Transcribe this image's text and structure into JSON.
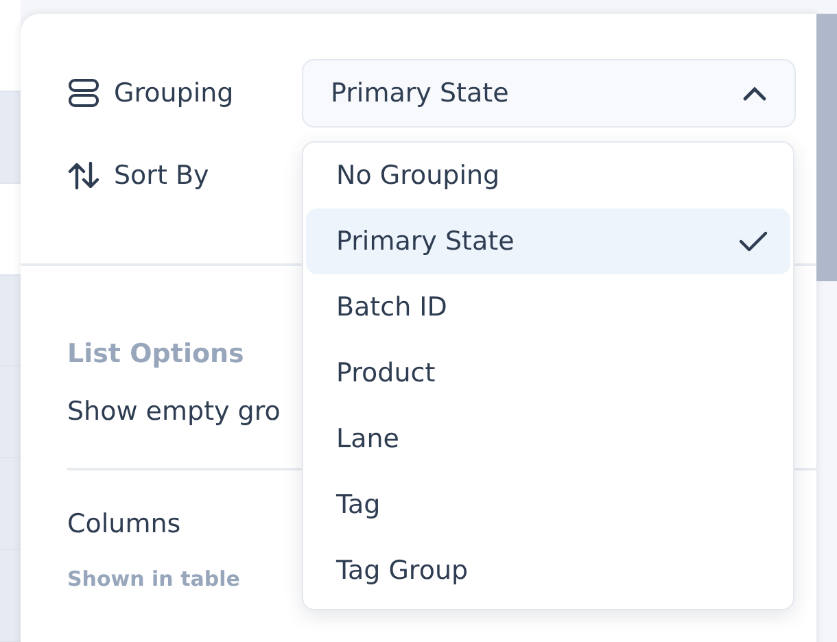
{
  "grouping": {
    "label": "Grouping",
    "value": "Primary State",
    "expanded": true,
    "options": [
      {
        "label": "No Grouping",
        "selected": false
      },
      {
        "label": "Primary State",
        "selected": true
      },
      {
        "label": "Batch ID",
        "selected": false
      },
      {
        "label": "Product",
        "selected": false
      },
      {
        "label": "Lane",
        "selected": false
      },
      {
        "label": "Tag",
        "selected": false
      },
      {
        "label": "Tag Group",
        "selected": false
      }
    ]
  },
  "sort_by": {
    "label": "Sort By"
  },
  "list_options": {
    "heading": "List Options",
    "show_empty_groups": {
      "label": "Show empty gro"
    }
  },
  "columns": {
    "heading": "Columns",
    "subheading": "Shown in table"
  }
}
